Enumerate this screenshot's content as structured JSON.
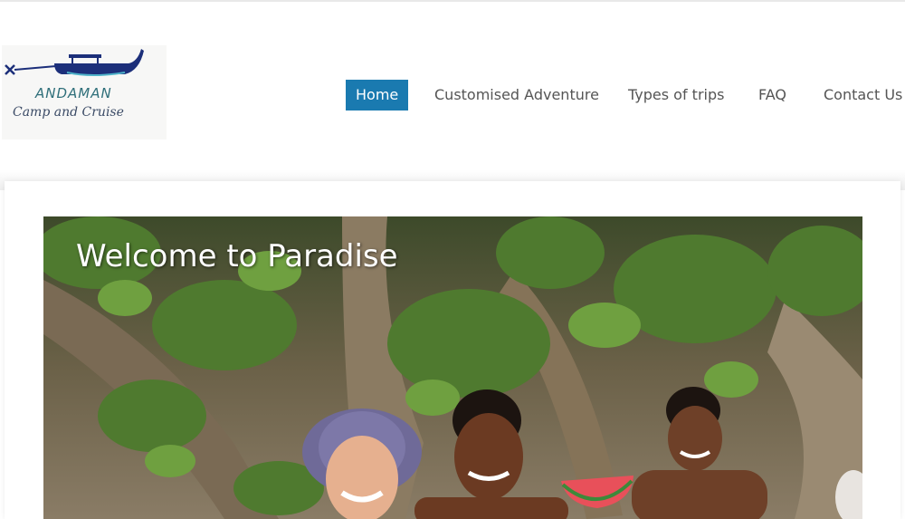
{
  "logo": {
    "brand": "ANDAMAN",
    "tagline": "Camp and Cruise"
  },
  "nav": {
    "items": [
      {
        "label": "Home",
        "active": true
      },
      {
        "label": "Customised Adventure",
        "active": false
      },
      {
        "label": "Types of trips",
        "active": false
      },
      {
        "label": "FAQ",
        "active": false
      },
      {
        "label": "Contact Us",
        "active": false
      }
    ]
  },
  "hero": {
    "title": "Welcome to Paradise"
  },
  "colors": {
    "accent": "#1a7ab0",
    "nav_text": "#555555",
    "logo_boat": "#1c2f7a",
    "logo_text": "#2f6f7a"
  }
}
